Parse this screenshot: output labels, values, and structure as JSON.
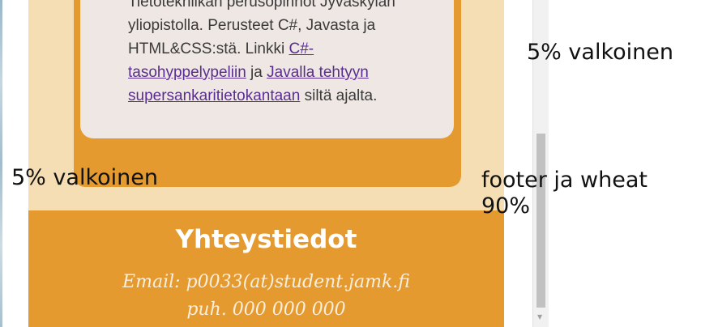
{
  "content_card": {
    "text_line_1": "Tietotekniikan perusopinnot Jyväskylän",
    "text_line_2": "yliopistolla. Perusteet C#, Javasta ja",
    "text_line_3_prefix": "HTML&CSS:stä. Linkki ",
    "link_1": "C#-tasohyppelypeliin",
    "link_1_part_a": "C#-",
    "link_1_part_b": "tasohyppelypeliin",
    "text_conjunction": " ja ",
    "link_2": "Javalla tehtyyn supersankaritietokantaan",
    "link_2_part_a": "Javalla tehtyyn",
    "link_2_part_b": "supersankaritietokantaan",
    "text_suffix": " siltä ajalta."
  },
  "footer": {
    "title": "Yhteystiedot",
    "email": "Email: p0033(at)student.jamk.fi",
    "phone": "puh. 000 000 000"
  },
  "annotations": {
    "top_right": "5% valkoinen",
    "left": "5% valkoinen",
    "footer_right_line1": "footer ja wheat",
    "footer_right_line2": "90%"
  },
  "colors": {
    "wheat": "#f5deb3",
    "orange": "#e59a2f",
    "card": "#efe7e4",
    "link": "#5a2d91",
    "white": "#ffffff"
  }
}
